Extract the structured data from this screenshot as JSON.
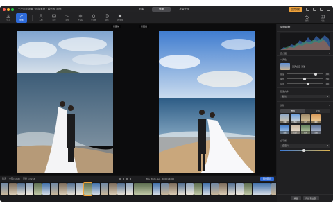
{
  "titlebar": {
    "title_text": "七夕限定场景 · 拍摄素材 · 婚纱照_精修",
    "tabs": [
      "图库",
      "修图",
      "批量处理"
    ],
    "upgrade_badge": "会员特权"
  },
  "toolbar": {
    "tools": [
      {
        "label": "导入",
        "icon": "import-icon"
      },
      {
        "label": "修图",
        "icon": "edit-icon"
      },
      {
        "label": "人像",
        "icon": "portrait-icon"
      },
      {
        "label": "背景",
        "icon": "background-icon"
      },
      {
        "label": "液化",
        "icon": "liquify-icon"
      },
      {
        "label": "去瑕疵",
        "icon": "heal-icon"
      },
      {
        "label": "去杂物",
        "icon": "remove-icon"
      },
      {
        "label": "调色",
        "icon": "color-icon"
      },
      {
        "label": "智能修图",
        "icon": "ai-icon"
      }
    ],
    "right_tools": [
      {
        "label": "撤销",
        "icon": "undo-icon"
      },
      {
        "label": "对比",
        "icon": "compare-icon"
      }
    ]
  },
  "viewer": {
    "left_label": "修图前",
    "right_label": "修图后",
    "hint": "按住空格键可拖动画面"
  },
  "panel": {
    "title": "调色精修",
    "histogram_label": "直方图",
    "section_preset": "AI调色",
    "preset_name": "蓝天白云-清透",
    "sliders": [
      {
        "label": "强度",
        "value": "80",
        "level": 0.8
      },
      {
        "label": "肤色",
        "value": "50",
        "level": 0.5
      },
      {
        "label": "氛围",
        "value": "60",
        "level": 0.6
      }
    ],
    "section_profile": "配置文件",
    "profile_select": "默认",
    "section_filter": "滤镜",
    "filter_tabs": [
      "推荐",
      "全部"
    ],
    "filter_tiles": [
      "原图",
      "清透",
      "胶片",
      "暖阳",
      "海蓝",
      "日系",
      "森系",
      "冷调"
    ],
    "section_light": "白平衡",
    "light_select": "自定义",
    "bottom_buttons": [
      "重置",
      "同步到全部"
    ]
  },
  "filmbar": {
    "left_items": [
      "筛选",
      "全部(3256)",
      "已修 1/3256"
    ],
    "file_name": "IMG_3621.jpg  ·  6000×4000",
    "right_button": "导出图片"
  },
  "colors": {
    "accent": "#2f6bd9",
    "highlight": "#f0a23a",
    "window_bg": "#1b1b1d",
    "panel_bg": "#202022"
  }
}
